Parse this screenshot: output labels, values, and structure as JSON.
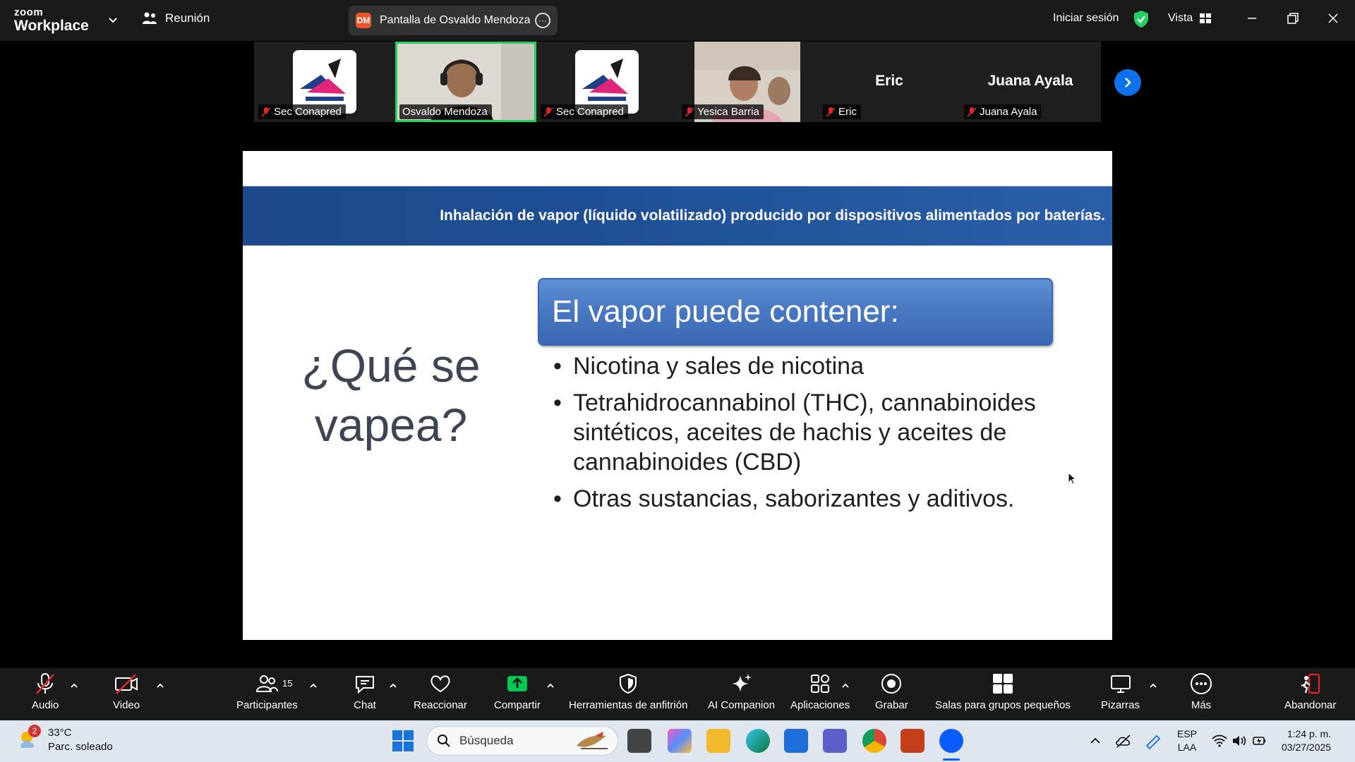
{
  "titlebar": {
    "brand_top": "zoom",
    "brand_bottom": "Workplace",
    "meeting_label": "Reunión",
    "share_initials": "DM",
    "share_label": "Pantalla de Osvaldo Mendoza",
    "signin_label": "Iniciar sesión",
    "view_label": "Vista"
  },
  "participants": [
    {
      "name": "Sec Conapred",
      "type": "logo"
    },
    {
      "name": "Osvaldo Mendoza",
      "type": "video",
      "active": true
    },
    {
      "name": "Sec Conapred",
      "type": "logo"
    },
    {
      "name": "Yesica Barria",
      "type": "video"
    },
    {
      "name": "Eric",
      "type": "text",
      "display": "Eric"
    },
    {
      "name": "Juana Ayala",
      "type": "text",
      "display": "Juana Ayala"
    }
  ],
  "slide": {
    "band_text": "Inhalación de vapor (líquido volatilizado) producido por dispositivos alimentados por baterías.",
    "question": "¿Qué se vapea?",
    "box_title": "El vapor puede contener:",
    "bullets": [
      "Nicotina y sales de nicotina",
      "Tetrahidrocannabinol (THC), cannabinoides sintéticos, aceites de hachis y aceites de cannabinoides (CBD)",
      "Otras sustancias, saborizantes y aditivos."
    ]
  },
  "toolbar": {
    "audio": "Audio",
    "video": "Video",
    "participants": "Participantes",
    "participants_count": "15",
    "chat": "Chat",
    "react": "Reaccionar",
    "share": "Compartir",
    "host_tools": "Herramientas de anfitrión",
    "ai": "AI Companion",
    "apps": "Aplicaciones",
    "record": "Grabar",
    "breakout": "Salas para grupos pequeños",
    "whiteboards": "Pizarras",
    "more": "Más",
    "leave": "Abandonar"
  },
  "taskbar": {
    "weather_badge": "2",
    "temperature": "33°C",
    "weather_desc": "Parc. soleado",
    "search_placeholder": "Búsqueda",
    "lang_top": "ESP",
    "lang_bottom": "LAA",
    "time": "1:24 p. m.",
    "date": "03/27/2025"
  },
  "colors": {
    "accent_green": "#23d160",
    "zoom_blue": "#0e72ed",
    "share_green": "#00c853",
    "leave_red": "#e02828"
  }
}
